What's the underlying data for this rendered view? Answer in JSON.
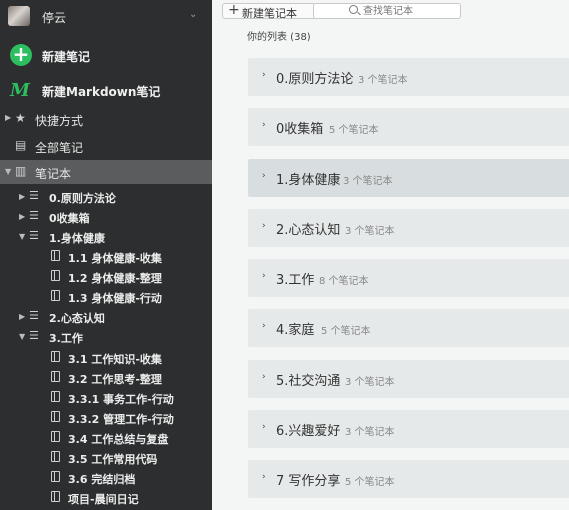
{
  "user": {
    "name": "停云"
  },
  "actions": {
    "new_note": "新建笔记",
    "new_markdown": "新建Markdown笔记"
  },
  "nav": {
    "shortcuts": "快捷方式",
    "all_notes": "全部笔记",
    "notebooks": "笔记本"
  },
  "tree": [
    {
      "label": "0.原则方法论"
    },
    {
      "label": "0收集箱"
    },
    {
      "label": "1.身体健康"
    },
    {
      "label": "1.1 身体健康-收集"
    },
    {
      "label": "1.2 身体健康-整理"
    },
    {
      "label": "1.3 身体健康-行动"
    },
    {
      "label": "2.心态认知"
    },
    {
      "label": "3.工作"
    },
    {
      "label": "3.1 工作知识-收集"
    },
    {
      "label": "3.2 工作思考-整理"
    },
    {
      "label": "3.3.1 事务工作-行动"
    },
    {
      "label": "3.3.2 管理工作-行动"
    },
    {
      "label": "3.4 工作总结与复盘"
    },
    {
      "label": "3.5  工作常用代码"
    },
    {
      "label": "3.6 完结归档"
    },
    {
      "label": "项目-晨间日记"
    }
  ],
  "toolbar": {
    "new_notebook": "新建笔记本",
    "search_placeholder": "查找笔记本"
  },
  "list": {
    "title": "你的列表 (38)",
    "cards": [
      {
        "name": "0.原则方法论",
        "count": "3 个笔记本"
      },
      {
        "name": "0收集箱",
        "count": "5 个笔记本"
      },
      {
        "name": "1.身体健康",
        "count": "3 个笔记本"
      },
      {
        "name": "2.心态认知",
        "count": "3 个笔记本"
      },
      {
        "name": "3.工作",
        "count": "8 个笔记本"
      },
      {
        "name": "4.家庭",
        "count": "5 个笔记本"
      },
      {
        "name": "5.社交沟通",
        "count": "3 个笔记本"
      },
      {
        "name": "6.兴趣爱好",
        "count": "3 个笔记本"
      },
      {
        "name": "7 写作分享",
        "count": "5 个笔记本"
      }
    ]
  },
  "colors": {
    "sidebar_bg": "#2c2e2f",
    "accent_green": "#2dbe60",
    "card_bg": "#e5e9e9",
    "main_bg": "#f4f5f5"
  }
}
